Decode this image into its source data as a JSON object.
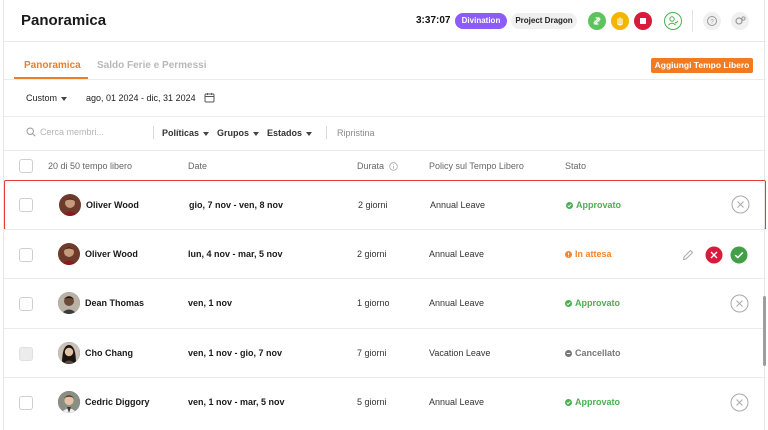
{
  "header": {
    "title": "Panoramica",
    "clock": "3:37:07",
    "badges": [
      {
        "label": "Divination",
        "color": "#8b5cf6"
      },
      {
        "label": "Project Dragon",
        "color": "#f0f0f0"
      }
    ],
    "icons": [
      "swap-icon",
      "hand-icon",
      "stop-icon",
      "user-check-icon",
      "help-icon",
      "settings-icon"
    ]
  },
  "tabs": [
    {
      "label": "Panoramica",
      "active": true
    },
    {
      "label": "Saldo Ferie e Permessi",
      "active": false
    }
  ],
  "add_button": "Aggiungi Tempo Libero",
  "range": {
    "selector": "Custom",
    "dates": "ago, 01 2024 - dic, 31 2024"
  },
  "filters": {
    "search_placeholder": "Cerca membri...",
    "politicas": "Políticas",
    "grupos": "Grupos",
    "estados": "Estados",
    "reset": "Ripristina"
  },
  "table": {
    "headers": {
      "count": "20 di 50 tempo libero",
      "date": "Date",
      "duration": "Durata",
      "policy": "Policy sul Tempo Libero",
      "status": "Stato"
    },
    "rows": [
      {
        "name": "Oliver Wood",
        "date": "gio, 7 nov - ven, 8 nov",
        "duration": "2 giorni",
        "policy": "Annual Leave",
        "status": "Approvato",
        "status_color": "#4caf50",
        "actions": [
          "cancel"
        ],
        "highlighted": true
      },
      {
        "name": "Oliver Wood",
        "date": "lun, 4 nov - mar, 5 nov",
        "duration": "2 giorni",
        "policy": "Annual Leave",
        "status": "In attesa",
        "status_color": "#f5842c",
        "actions": [
          "edit",
          "reject",
          "approve"
        ],
        "highlighted": false
      },
      {
        "name": "Dean Thomas",
        "date": "ven, 1 nov",
        "duration": "1 giorno",
        "policy": "Annual Leave",
        "status": "Approvato",
        "status_color": "#4caf50",
        "actions": [
          "cancel"
        ],
        "highlighted": false
      },
      {
        "name": "Cho Chang",
        "date": "ven, 1 nov - gio, 7 nov",
        "duration": "7 giorni",
        "policy": "Vacation Leave",
        "status": "Cancellato",
        "status_color": "#777777",
        "actions": [],
        "highlighted": false
      },
      {
        "name": "Cedric Diggory",
        "date": "ven, 1 nov - mar, 5 nov",
        "duration": "5 giorni",
        "policy": "Annual Leave",
        "status": "Approvato",
        "status_color": "#4caf50",
        "actions": [
          "cancel"
        ],
        "highlighted": false
      }
    ]
  },
  "colors": {
    "accent": "#ef7d22",
    "highlight_border": "#e53935",
    "approve": "#43a047",
    "reject": "#d81b3c"
  }
}
